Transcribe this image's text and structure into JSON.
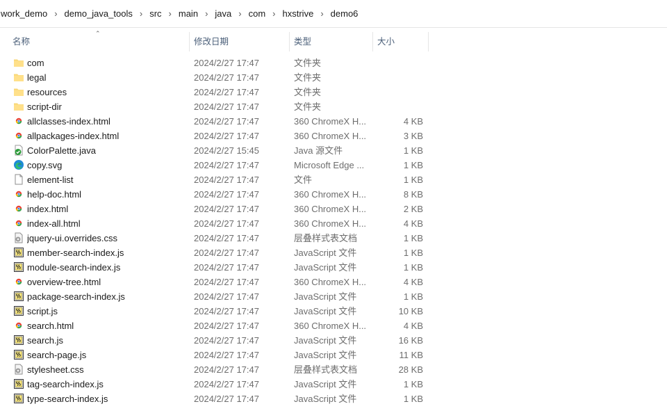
{
  "breadcrumb": [
    "work_demo",
    "demo_java_tools",
    "src",
    "main",
    "java",
    "com",
    "hxstrive",
    "demo6"
  ],
  "columns": {
    "name": "名称",
    "date": "修改日期",
    "type": "类型",
    "size": "大小"
  },
  "files": [
    {
      "name": "com",
      "date": "2024/2/27 17:47",
      "type": "文件夹",
      "size": "",
      "icon": "folder-icon"
    },
    {
      "name": "legal",
      "date": "2024/2/27 17:47",
      "type": "文件夹",
      "size": "",
      "icon": "folder-icon"
    },
    {
      "name": "resources",
      "date": "2024/2/27 17:47",
      "type": "文件夹",
      "size": "",
      "icon": "folder-icon"
    },
    {
      "name": "script-dir",
      "date": "2024/2/27 17:47",
      "type": "文件夹",
      "size": "",
      "icon": "folder-icon"
    },
    {
      "name": "allclasses-index.html",
      "date": "2024/2/27 17:47",
      "type": "360 ChromeX H...",
      "size": "4 KB",
      "icon": "chrome-html-icon"
    },
    {
      "name": "allpackages-index.html",
      "date": "2024/2/27 17:47",
      "type": "360 ChromeX H...",
      "size": "3 KB",
      "icon": "chrome-html-icon"
    },
    {
      "name": "ColorPalette.java",
      "date": "2024/2/27 15:45",
      "type": "Java 源文件",
      "size": "1 KB",
      "icon": "java-file-icon"
    },
    {
      "name": "copy.svg",
      "date": "2024/2/27 17:47",
      "type": "Microsoft Edge ...",
      "size": "1 KB",
      "icon": "edge-icon"
    },
    {
      "name": "element-list",
      "date": "2024/2/27 17:47",
      "type": "文件",
      "size": "1 KB",
      "icon": "blank-file-icon"
    },
    {
      "name": "help-doc.html",
      "date": "2024/2/27 17:47",
      "type": "360 ChromeX H...",
      "size": "8 KB",
      "icon": "chrome-html-icon"
    },
    {
      "name": "index.html",
      "date": "2024/2/27 17:47",
      "type": "360 ChromeX H...",
      "size": "2 KB",
      "icon": "chrome-html-icon"
    },
    {
      "name": "index-all.html",
      "date": "2024/2/27 17:47",
      "type": "360 ChromeX H...",
      "size": "4 KB",
      "icon": "chrome-html-icon"
    },
    {
      "name": "jquery-ui.overrides.css",
      "date": "2024/2/27 17:47",
      "type": "层叠样式表文档",
      "size": "1 KB",
      "icon": "css-file-icon"
    },
    {
      "name": "member-search-index.js",
      "date": "2024/2/27 17:47",
      "type": "JavaScript 文件",
      "size": "1 KB",
      "icon": "js-file-icon"
    },
    {
      "name": "module-search-index.js",
      "date": "2024/2/27 17:47",
      "type": "JavaScript 文件",
      "size": "1 KB",
      "icon": "js-file-icon"
    },
    {
      "name": "overview-tree.html",
      "date": "2024/2/27 17:47",
      "type": "360 ChromeX H...",
      "size": "4 KB",
      "icon": "chrome-html-icon"
    },
    {
      "name": "package-search-index.js",
      "date": "2024/2/27 17:47",
      "type": "JavaScript 文件",
      "size": "1 KB",
      "icon": "js-file-icon"
    },
    {
      "name": "script.js",
      "date": "2024/2/27 17:47",
      "type": "JavaScript 文件",
      "size": "10 KB",
      "icon": "js-file-icon"
    },
    {
      "name": "search.html",
      "date": "2024/2/27 17:47",
      "type": "360 ChromeX H...",
      "size": "4 KB",
      "icon": "chrome-html-icon"
    },
    {
      "name": "search.js",
      "date": "2024/2/27 17:47",
      "type": "JavaScript 文件",
      "size": "16 KB",
      "icon": "js-file-icon"
    },
    {
      "name": "search-page.js",
      "date": "2024/2/27 17:47",
      "type": "JavaScript 文件",
      "size": "11 KB",
      "icon": "js-file-icon"
    },
    {
      "name": "stylesheet.css",
      "date": "2024/2/27 17:47",
      "type": "层叠样式表文档",
      "size": "28 KB",
      "icon": "css-file-icon"
    },
    {
      "name": "tag-search-index.js",
      "date": "2024/2/27 17:47",
      "type": "JavaScript 文件",
      "size": "1 KB",
      "icon": "js-file-icon"
    },
    {
      "name": "type-search-index.js",
      "date": "2024/2/27 17:47",
      "type": "JavaScript 文件",
      "size": "1 KB",
      "icon": "js-file-icon"
    }
  ]
}
